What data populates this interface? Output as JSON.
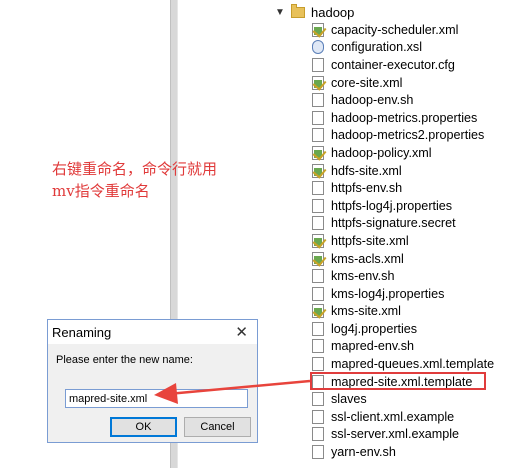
{
  "tree": {
    "folder_name": "hadoop",
    "files": [
      {
        "name": "capacity-scheduler.xml",
        "icon": "xml-file-icon"
      },
      {
        "name": "configuration.xsl",
        "icon": "xsl-file-icon"
      },
      {
        "name": "container-executor.cfg",
        "icon": "file-icon"
      },
      {
        "name": "core-site.xml",
        "icon": "xml-file-icon"
      },
      {
        "name": "hadoop-env.sh",
        "icon": "file-icon"
      },
      {
        "name": "hadoop-metrics.properties",
        "icon": "file-icon"
      },
      {
        "name": "hadoop-metrics2.properties",
        "icon": "file-icon"
      },
      {
        "name": "hadoop-policy.xml",
        "icon": "xml-file-icon"
      },
      {
        "name": "hdfs-site.xml",
        "icon": "xml-file-icon"
      },
      {
        "name": "httpfs-env.sh",
        "icon": "file-icon"
      },
      {
        "name": "httpfs-log4j.properties",
        "icon": "file-icon"
      },
      {
        "name": "httpfs-signature.secret",
        "icon": "file-icon"
      },
      {
        "name": "httpfs-site.xml",
        "icon": "xml-file-icon"
      },
      {
        "name": "kms-acls.xml",
        "icon": "xml-file-icon"
      },
      {
        "name": "kms-env.sh",
        "icon": "file-icon"
      },
      {
        "name": "kms-log4j.properties",
        "icon": "file-icon"
      },
      {
        "name": "kms-site.xml",
        "icon": "xml-file-icon"
      },
      {
        "name": "log4j.properties",
        "icon": "file-icon"
      },
      {
        "name": "mapred-env.sh",
        "icon": "file-icon"
      },
      {
        "name": "mapred-queues.xml.template",
        "icon": "file-icon"
      },
      {
        "name": "mapred-site.xml.template",
        "icon": "file-icon",
        "highlighted": true
      },
      {
        "name": "slaves",
        "icon": "file-icon"
      },
      {
        "name": "ssl-client.xml.example",
        "icon": "file-icon"
      },
      {
        "name": "ssl-server.xml.example",
        "icon": "file-icon"
      },
      {
        "name": "yarn-env.sh",
        "icon": "file-icon"
      }
    ]
  },
  "annotation": {
    "line1": "右键重命名，命令行就用",
    "line2": "mv指令重命名"
  },
  "dialog": {
    "title": "Renaming",
    "prompt": "Please enter the new name:",
    "input_value": "mapred-site.xml",
    "ok_label": "OK",
    "cancel_label": "Cancel"
  },
  "colors": {
    "annotation_red": "#e03a3a",
    "highlight_border": "#e03c3c",
    "dialog_accent": "#0078d7"
  }
}
